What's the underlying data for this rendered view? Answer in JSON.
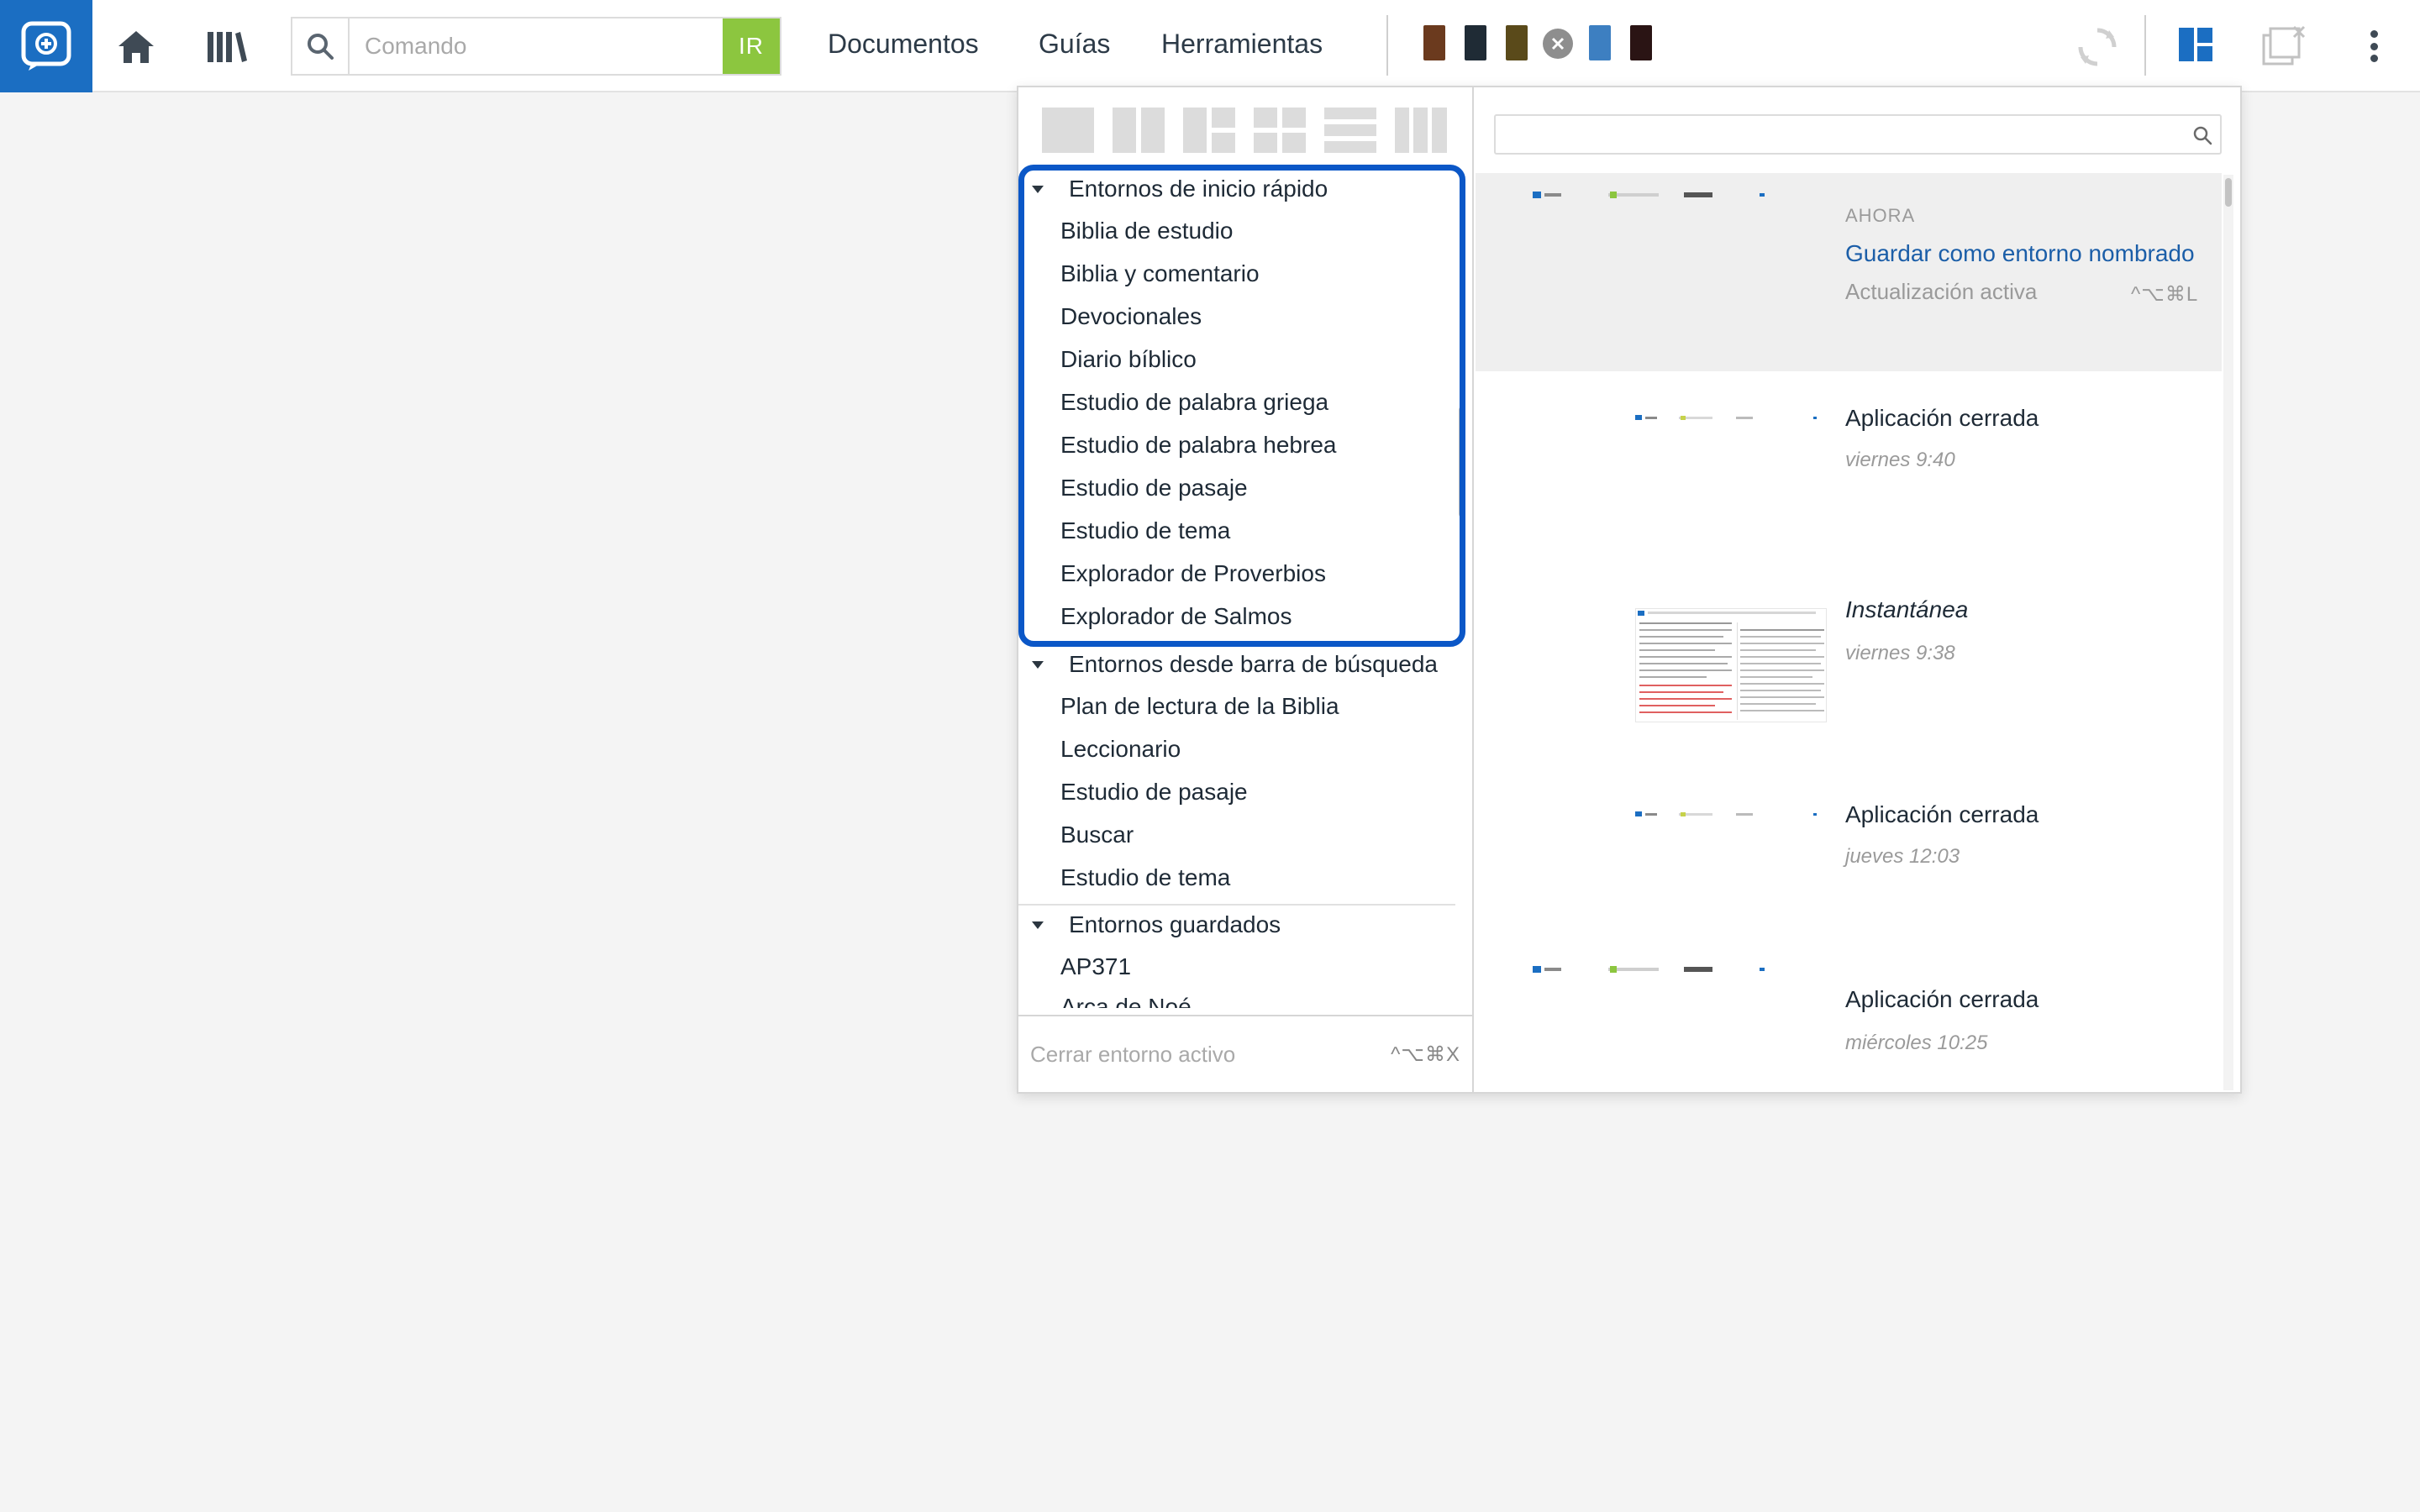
{
  "topbar": {
    "command_placeholder": "Comando",
    "go_label": "IR",
    "nav": {
      "documents": "Documentos",
      "guides": "Guías",
      "tools": "Herramientas"
    },
    "recent_books": [
      {
        "name": "book-1",
        "color": "#6b3a1e"
      },
      {
        "name": "book-2",
        "color": "#1f2b35"
      },
      {
        "name": "book-3",
        "color": "#5a4a1a"
      },
      {
        "name": "book-4-closed",
        "color": "#8e8e8e"
      },
      {
        "name": "book-5",
        "color": "#3d7fc1"
      },
      {
        "name": "book-6",
        "color": "#2a1414"
      }
    ]
  },
  "layouts_panel": {
    "groups": [
      {
        "title": "Entornos de inicio rápido",
        "items": [
          "Biblia de estudio",
          "Biblia y comentario",
          "Devocionales",
          "Diario bíblico",
          "Estudio de palabra griega",
          "Estudio de palabra hebrea",
          "Estudio de pasaje",
          "Estudio de tema",
          "Explorador de Proverbios",
          "Explorador de Salmos"
        ]
      },
      {
        "title": "Entornos desde barra de búsqueda",
        "items": [
          "Plan de lectura de la Biblia",
          "Leccionario",
          "Estudio de pasaje",
          "Buscar",
          "Estudio de tema"
        ]
      },
      {
        "title": "Entornos guardados",
        "items": [
          "AP371",
          "Arca de Noé"
        ]
      }
    ],
    "footer": {
      "close_label": "Cerrar entorno activo",
      "close_shortcut": "^⌥⌘X"
    },
    "history": [
      {
        "label": "AHORA",
        "title": "Guardar como entorno nombrado",
        "status": "Actualización activa",
        "shortcut": "^⌥⌘L"
      },
      {
        "title": "Aplicación cerrada",
        "time": "viernes 9:40"
      },
      {
        "title": "Instantánea",
        "time": "viernes 9:38"
      },
      {
        "title": "Aplicación cerrada",
        "time": "jueves 12:03"
      },
      {
        "title": "Aplicación cerrada",
        "time": "miércoles 10:25"
      }
    ]
  },
  "colors": {
    "brand": "#1b6ec2",
    "go_button": "#8cc63f",
    "highlight_border": "#0b57c7",
    "link": "#1b5ea8"
  }
}
